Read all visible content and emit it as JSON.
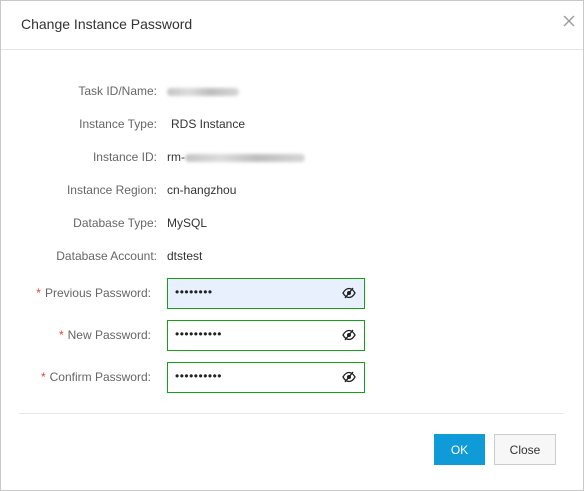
{
  "dialog": {
    "title": "Change Instance Password",
    "close_icon": "close-x-icon"
  },
  "info": {
    "task_label": "Task ID/Name:",
    "type_label": "Instance Type:",
    "type_value": "RDS Instance",
    "id_label": "Instance ID:",
    "id_prefix": "rm-",
    "region_label": "Instance Region:",
    "region_value": "cn-hangzhou",
    "db_type_label": "Database Type:",
    "db_type_value": "MySQL",
    "account_label": "Database Account:",
    "account_value": "dtstest"
  },
  "form": {
    "required_mark": "*",
    "previous_label": "Previous Password:",
    "previous_value": "••••••••",
    "new_label": "New Password:",
    "new_value": "••••••••••",
    "confirm_label": "Confirm Password:",
    "confirm_value": "••••••••••",
    "eye_icon": "eye-toggle-icon"
  },
  "footer": {
    "ok_label": "OK",
    "close_label": "Close"
  },
  "colors": {
    "primary": "#0f9bd7",
    "required": "#e8432a",
    "field_border": "#15a01a",
    "focused_fill": "#e8f0fe"
  }
}
